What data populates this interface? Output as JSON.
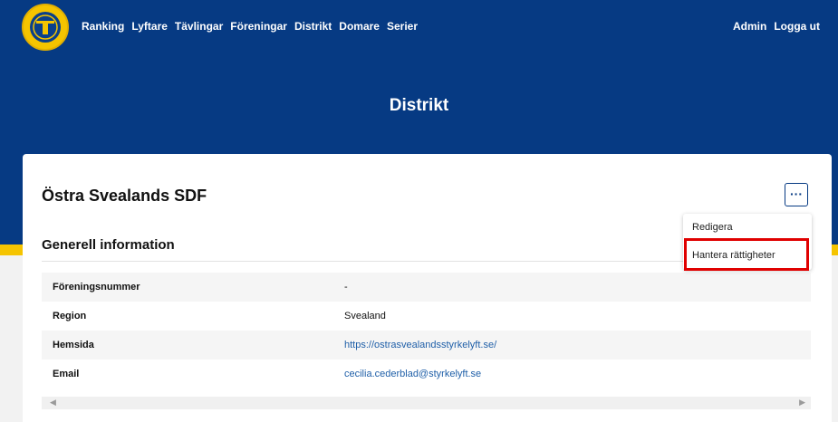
{
  "nav": {
    "items": [
      {
        "label": "Ranking"
      },
      {
        "label": "Lyftare"
      },
      {
        "label": "Tävlingar"
      },
      {
        "label": "Föreningar"
      },
      {
        "label": "Distrikt"
      },
      {
        "label": "Domare"
      },
      {
        "label": "Serier"
      }
    ],
    "right": {
      "admin": "Admin",
      "logout": "Logga ut"
    }
  },
  "hero": {
    "title": "Distrikt"
  },
  "card": {
    "title": "Östra Svealands SDF",
    "menu_button": "···",
    "section_title": "Generell information",
    "rows": [
      {
        "key": "Föreningsnummer",
        "value": "-"
      },
      {
        "key": "Region",
        "value": "Svealand"
      },
      {
        "key": "Hemsida",
        "value": "https://ostrasvealandsstyrkelyft.se/"
      },
      {
        "key": "Email",
        "value": "cecilia.cederblad@styrkelyft.se"
      }
    ]
  },
  "dropdown": {
    "items": [
      {
        "label": "Redigera"
      },
      {
        "label": "Hantera rättigheter"
      }
    ]
  },
  "colors": {
    "primary": "#063a83",
    "accent": "#f5c400",
    "highlight": "#e00000"
  },
  "icons": {
    "logo": "federation-logo",
    "scroll_left": "scroll-left-icon",
    "scroll_right": "scroll-right-icon"
  }
}
